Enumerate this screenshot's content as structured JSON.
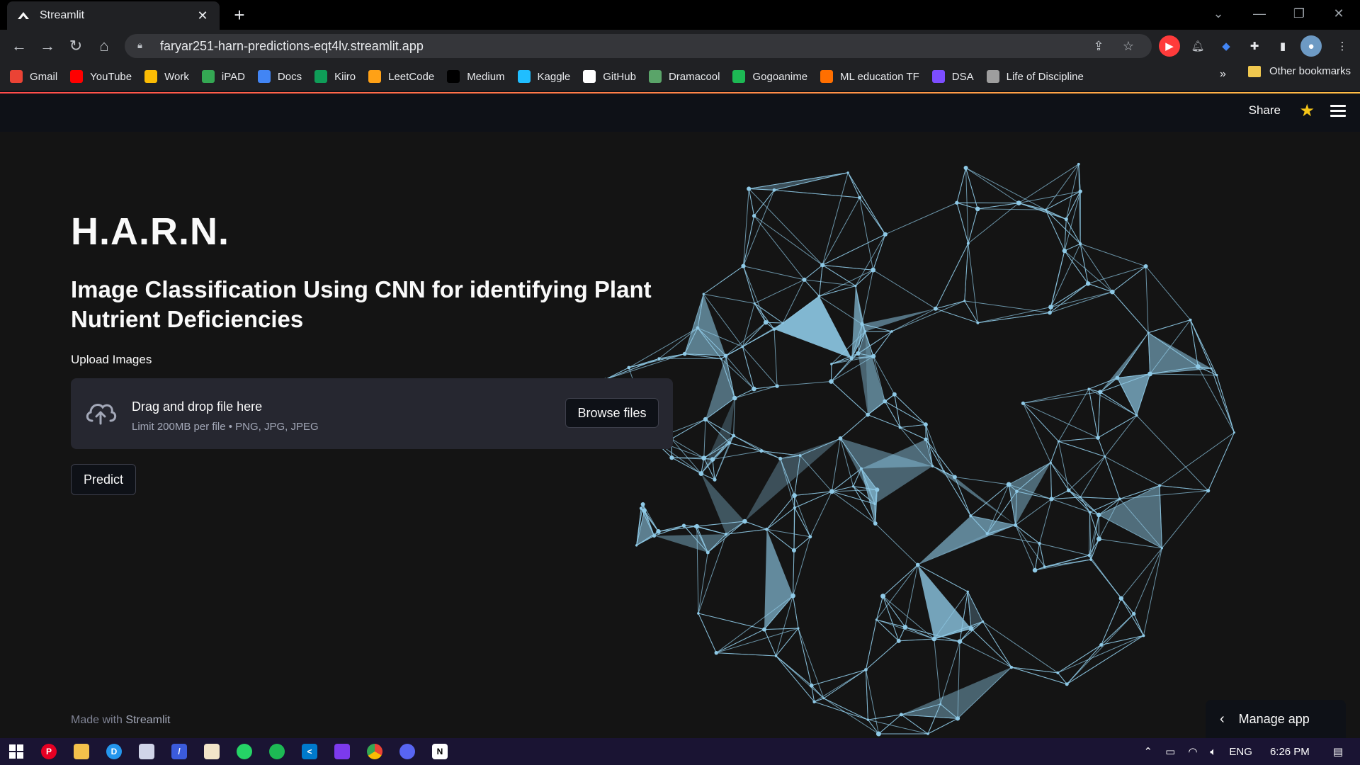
{
  "browser": {
    "tab_title": "Streamlit",
    "url": "faryar251-harn-predictions-eqt4lv.streamlit.app",
    "bookmarks": [
      {
        "label": "Gmail",
        "icon": "gmail-icon",
        "color": "#ea4335"
      },
      {
        "label": "YouTube",
        "icon": "youtube-icon",
        "color": "#ff0000"
      },
      {
        "label": "Work",
        "icon": "drive-icon",
        "color": "#fbbc04"
      },
      {
        "label": "iPAD",
        "icon": "drive-icon",
        "color": "#34a853"
      },
      {
        "label": "Docs",
        "icon": "docs-icon",
        "color": "#4285f4"
      },
      {
        "label": "Kiiro",
        "icon": "sheets-icon",
        "color": "#0f9d58"
      },
      {
        "label": "LeetCode",
        "icon": "leetcode-icon",
        "color": "#ffa116"
      },
      {
        "label": "Medium",
        "icon": "medium-icon",
        "color": "#000000"
      },
      {
        "label": "Kaggle",
        "icon": "kaggle-icon",
        "color": "#20beff"
      },
      {
        "label": "GitHub",
        "icon": "github-icon",
        "color": "#ffffff"
      },
      {
        "label": "Dramacool",
        "icon": "dramacool-icon",
        "color": "#5aa469"
      },
      {
        "label": "Gogoanime",
        "icon": "gogoanime-icon",
        "color": "#1db954"
      },
      {
        "label": "ML education TF",
        "icon": "tensorflow-icon",
        "color": "#ff6f00"
      },
      {
        "label": "DSA",
        "icon": "dsa-icon",
        "color": "#7c4dff"
      },
      {
        "label": "Life of Discipline",
        "icon": "discipline-icon",
        "color": "#9e9e9e"
      }
    ],
    "more_label": "»",
    "other_bookmarks": "Other bookmarks"
  },
  "app": {
    "share_label": "Share",
    "title": "H.A.R.N.",
    "subtitle": "Image Classification Using CNN for identifying Plant Nutrient Deficiencies",
    "upload_label": "Upload Images",
    "dropzone_title": "Drag and drop file here",
    "dropzone_limit": "Limit 200MB per file • PNG, JPG, JPEG",
    "browse_label": "Browse files",
    "predict_label": "Predict",
    "footer_prefix": "Made with",
    "footer_brand": "Streamlit",
    "manage_label": "Manage app",
    "accent_color": "#ff4b4b",
    "network_color": "#8ec9e6"
  },
  "taskbar": {
    "language": "ENG",
    "time": "6:26 PM"
  }
}
